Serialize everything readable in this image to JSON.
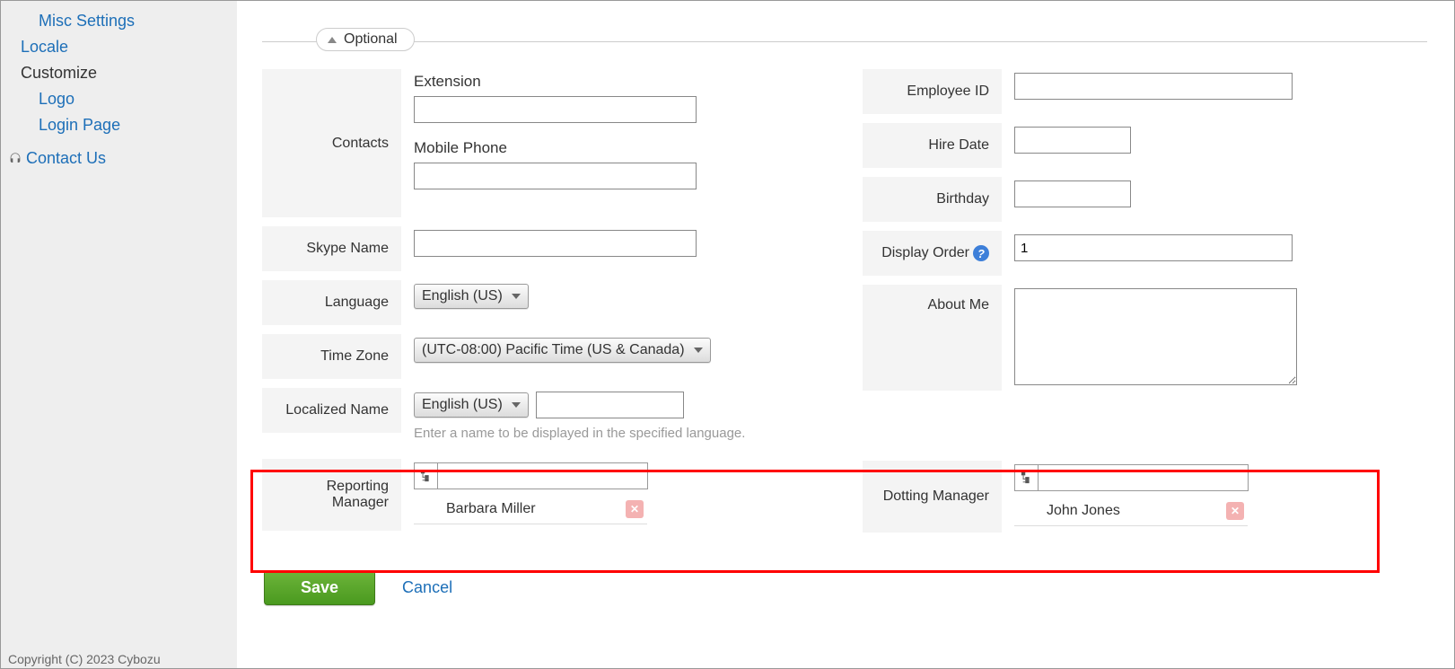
{
  "sidebar": {
    "misc_settings": "Misc Settings",
    "locale": "Locale",
    "customize_heading": "Customize",
    "logo": "Logo",
    "login_page": "Login Page",
    "contact_us": "Contact Us"
  },
  "legend": "Optional",
  "left": {
    "contacts_label": "Contacts",
    "extension_label": "Extension",
    "mobile_label": "Mobile Phone",
    "skype_label": "Skype Name",
    "language_label": "Language",
    "language_value": "English (US)",
    "timezone_label": "Time Zone",
    "timezone_value": "(UTC-08:00) Pacific Time (US & Canada)",
    "localized_label": "Localized Name",
    "localized_lang_value": "English (US)",
    "localized_hint": "Enter a name to be displayed in the specified language.",
    "reporting_label": "Reporting Manager",
    "reporting_name": "Barbara Miller"
  },
  "right": {
    "employee_id_label": "Employee ID",
    "hire_date_label": "Hire Date",
    "birthday_label": "Birthday",
    "display_order_label": "Display Order",
    "display_order_value": "1",
    "about_me_label": "About Me",
    "dotting_label": "Dotting Manager",
    "dotting_name": "John Jones"
  },
  "buttons": {
    "save": "Save",
    "cancel": "Cancel"
  },
  "footer": "Copyright (C) 2023 Cybozu"
}
